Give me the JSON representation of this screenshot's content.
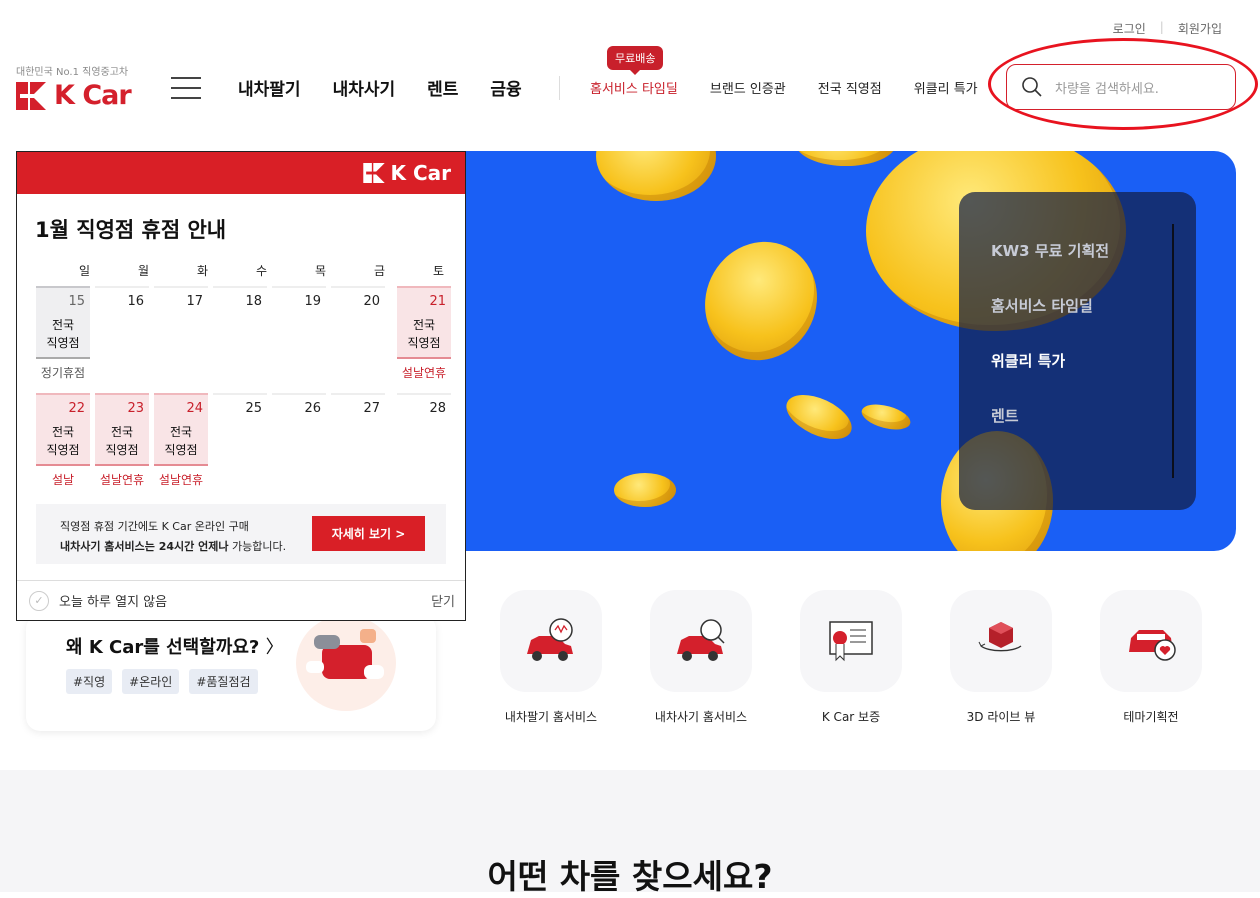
{
  "header": {
    "login": "로그인",
    "signup": "회원가입",
    "tagline": "대한민국 No.1 직영중고차",
    "brand": "K Car",
    "main_nav": [
      "내차팔기",
      "내차사기",
      "렌트",
      "금융"
    ],
    "sub_nav": [
      "홈서비스 타임딜",
      "브랜드 인증관",
      "전국 직영점",
      "위클리 특가"
    ],
    "badge": "무료배송",
    "search_placeholder": "차량을 검색하세요."
  },
  "hero": {
    "menu": [
      "KW3 무료 기획전",
      "홈서비스 타임딜",
      "위클리 특가",
      "렌트"
    ],
    "active_index": 2
  },
  "popup": {
    "brand": "K Car",
    "title": "1월 직영점 휴점 안내",
    "days_of_week": [
      "일",
      "월",
      "화",
      "수",
      "목",
      "금",
      "토"
    ],
    "week1": [
      "15",
      "16",
      "17",
      "18",
      "19",
      "20",
      "21"
    ],
    "week2": [
      "22",
      "23",
      "24",
      "25",
      "26",
      "27",
      "28"
    ],
    "closed_label_line1": "전국",
    "closed_label_line2": "직영점",
    "caption_regular": "정기휴점",
    "caption_holiday": "설날연휴",
    "caption_seollal": "설날",
    "info_line1": "직영점 휴점 기간에도 K Car 온라인 구매",
    "info_line2_bold": "내차사기 홈서비스는 24시간 언제나",
    "info_line2_rest": " 가능합니다.",
    "info_button": "자세히 보기 >",
    "no_show_today": "오늘 하루 열지 않음",
    "close": "닫기"
  },
  "why": {
    "title": "왜 K Car를 선택할까요?",
    "tags": [
      "#직영",
      "#온라인",
      "#품질점검"
    ]
  },
  "quick_menu": [
    {
      "label": "내차팔기 홈서비스",
      "icon": "car-sell-icon"
    },
    {
      "label": "내차사기 홈서비스",
      "icon": "car-search-icon"
    },
    {
      "label": "K Car 보증",
      "icon": "certificate-icon"
    },
    {
      "label": "3D 라이브 뷰",
      "icon": "3d-cube-icon"
    },
    {
      "label": "테마기획전",
      "icon": "car-heart-icon"
    }
  ],
  "section": {
    "title": "어떤 차를 찾으세요?"
  },
  "colors": {
    "brand_red": "#d4202c",
    "hero_blue": "#1a5ff5",
    "annotation_red": "#e8131f"
  }
}
